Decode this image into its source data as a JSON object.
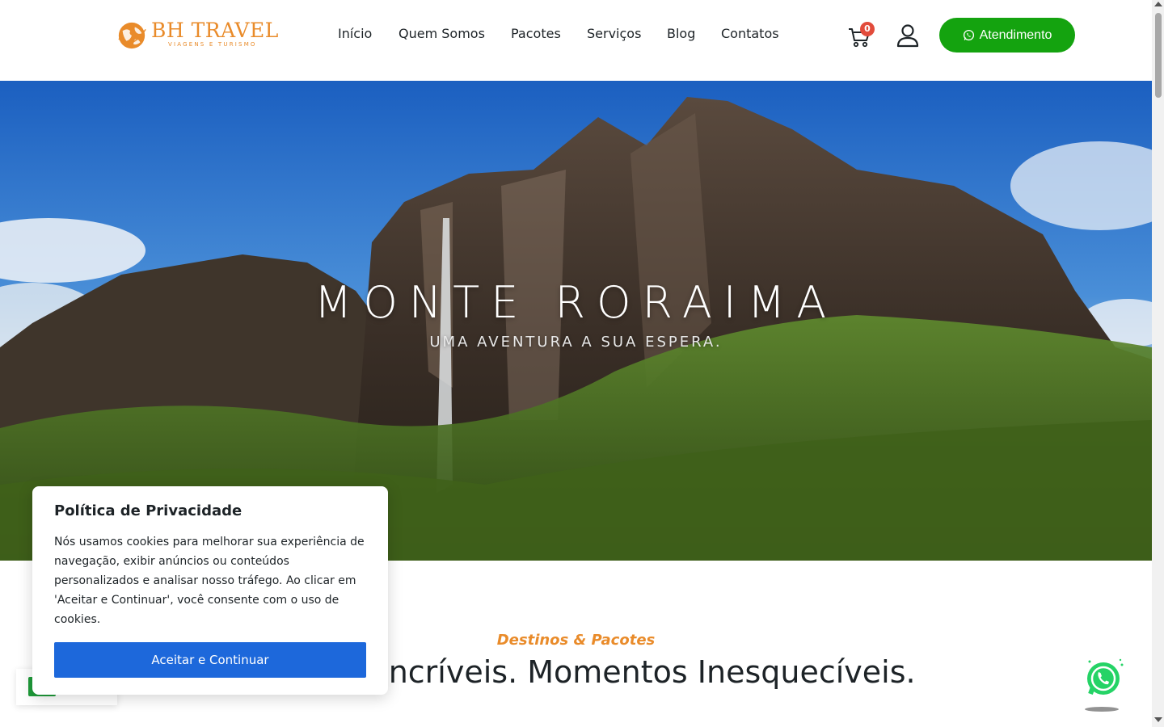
{
  "brand": {
    "title": "BH TRAVEL",
    "subtitle": "VIAGENS E TURISMO",
    "color": "#e98b2a"
  },
  "nav": {
    "items": [
      {
        "label": "Início"
      },
      {
        "label": "Quem Somos"
      },
      {
        "label": "Pacotes"
      },
      {
        "label": "Serviços"
      },
      {
        "label": "Blog"
      },
      {
        "label": "Contatos"
      }
    ]
  },
  "cart": {
    "count": "0",
    "icon": "cart-icon"
  },
  "user": {
    "icon": "user-icon"
  },
  "cta": {
    "label": "Atendimento",
    "icon": "whatsapp-icon",
    "color": "#14a30f"
  },
  "hero": {
    "title": "MONTE RORAIMA",
    "subtitle": "UMA AVENTURA A SUA ESPERA."
  },
  "section": {
    "kicker": "Destinos & Pacotes",
    "title": "Destinos Incríveis. Momentos Inesquecíveis."
  },
  "cookie": {
    "title": "Política de Privacidade",
    "text": "Nós usamos cookies para melhorar sua experiência de navegação, exibir anúncios ou conteúdos personalizados e analisar nosso tráfego. Ao clicar em 'Aceitar e Continuar', você consente com o uso de cookies.",
    "button_label": "Aceitar e Continuar",
    "button_color": "#1d68db"
  },
  "floating_whatsapp": {
    "icon": "whatsapp-icon"
  },
  "language_widget": {
    "icon": "brazil-flag-icon"
  }
}
